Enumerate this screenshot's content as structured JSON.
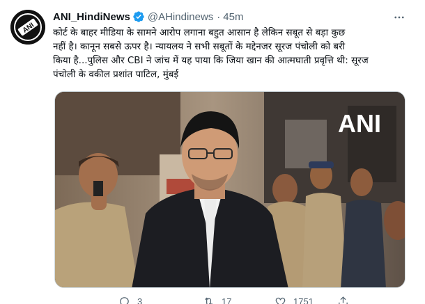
{
  "tweet": {
    "display_name": "ANI_HindiNews",
    "handle": "@AHindinews",
    "separator": "·",
    "time": "45m",
    "text_lines": [
      "कोर्ट के बाहर मीडिया के सामने आरोप लगाना बहुत आसान है लेकिन सबूत से बड़ा कुछ",
      "नहीं है। कानून सबसे ऊपर है। न्यायलय ने सभी सबूतों के मद्देनजर सूरज पंचोली को बरी",
      "किया है...पुलिस और CBI ने जांच में यह पाया कि जिया खान की आत्मघाती प्रवृत्ति थी: सूरज",
      "पंचोली के वकील प्रशांत पाटिल, मुंबई"
    ],
    "media_watermark": "ANI",
    "avatar_text": "ANI",
    "stats": {
      "replies": "3",
      "retweets": "17",
      "likes": "1751"
    }
  },
  "colors": {
    "text": "#0f1419",
    "muted": "#536471",
    "verified": "#1d9bf0",
    "border": "#cfd9de"
  },
  "icons": [
    "verified-badge-icon",
    "more-options-icon",
    "reply-icon",
    "retweet-icon",
    "like-icon",
    "share-icon"
  ]
}
